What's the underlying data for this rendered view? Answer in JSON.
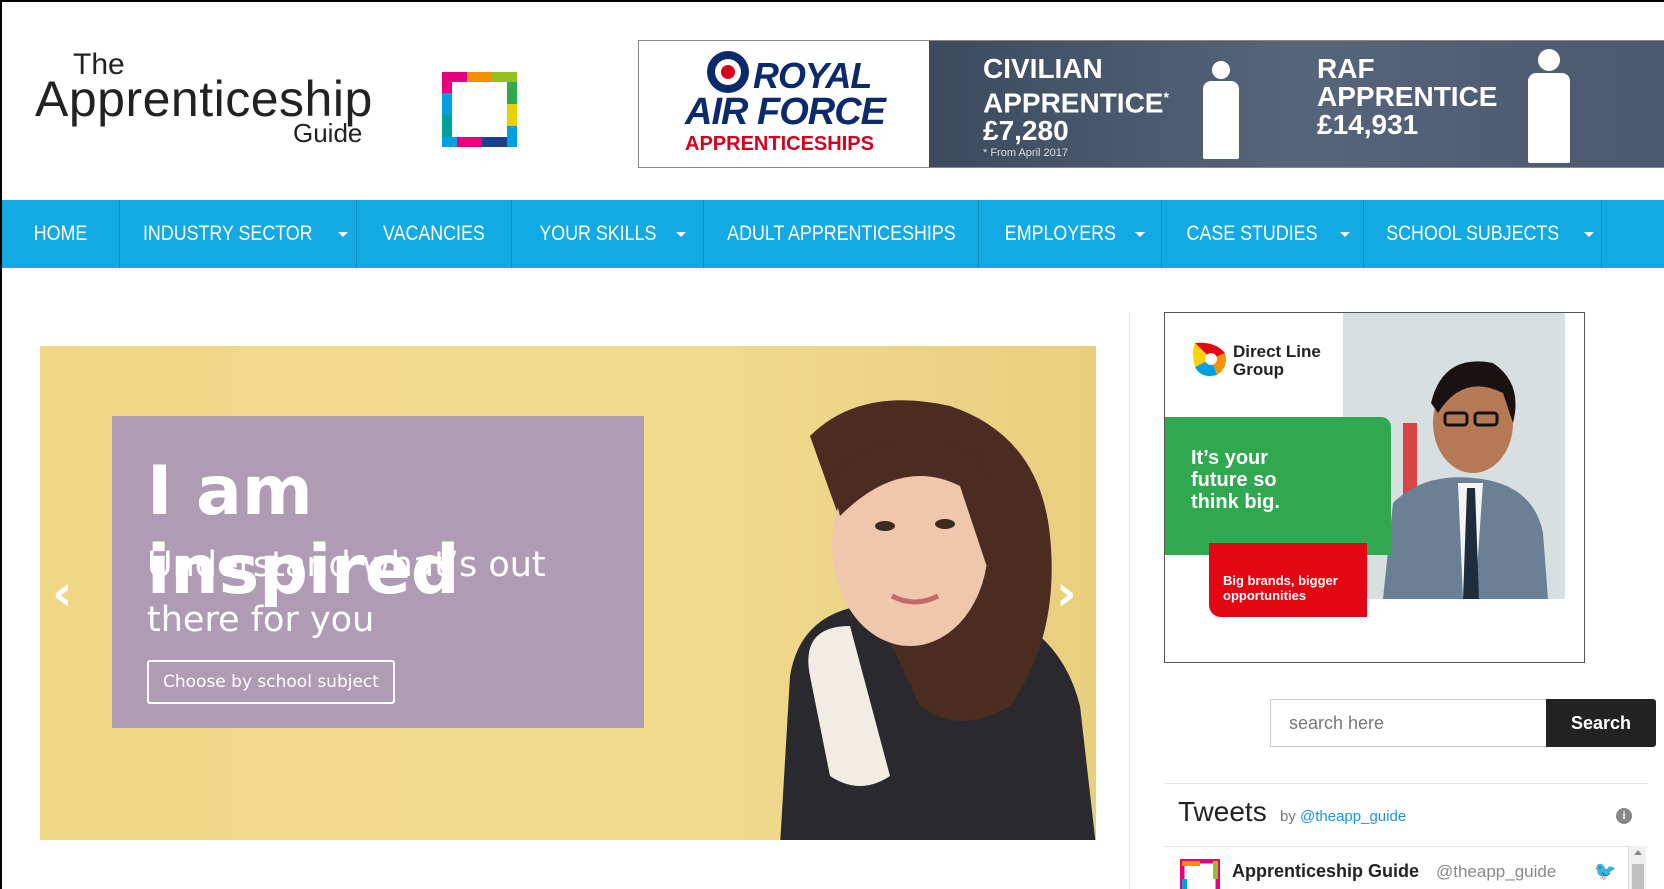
{
  "logo": {
    "line1": "The",
    "line2": "Apprenticeship",
    "line3": "Guide"
  },
  "raf_ad": {
    "royal": "ROYAL",
    "air_force": "AIR FORCE",
    "apprenticeships": "APPRENTICESHIPS",
    "civilian": {
      "line1": "CIVILIAN",
      "line2": "APPRENTICE",
      "mark": "*",
      "salary": "£7,280"
    },
    "raf": {
      "line1": "RAF",
      "line2": "APPRENTICE",
      "salary": "£14,931"
    },
    "note": "* From April 2017"
  },
  "nav": [
    {
      "label": "HOME",
      "dropdown": false
    },
    {
      "label": "INDUSTRY SECTOR",
      "dropdown": true
    },
    {
      "label": "VACANCIES",
      "dropdown": false
    },
    {
      "label": "YOUR SKILLS",
      "dropdown": true
    },
    {
      "label": "ADULT APPRENTICESHIPS",
      "dropdown": false
    },
    {
      "label": "EMPLOYERS",
      "dropdown": true
    },
    {
      "label": "CASE STUDIES",
      "dropdown": true
    },
    {
      "label": "SCHOOL SUBJECTS",
      "dropdown": true
    }
  ],
  "hero": {
    "title": "I am inspired",
    "subtitle": "Understand what’s out there for you",
    "button": "Choose by school subject",
    "prev": "‹",
    "next": "›"
  },
  "sidebar_ad": {
    "brand_line1": "Direct Line",
    "brand_line2": "Group",
    "headline": "It’s your future so think big.",
    "tagline": "Big brands, bigger opportunities"
  },
  "search": {
    "placeholder": "search here",
    "button": "Search"
  },
  "tweets": {
    "title": "Tweets",
    "by": "by",
    "handle": "@theapp_guide",
    "info": "i",
    "author_name": "Apprenticeship Guide",
    "author_handle": "@theapp_guide"
  },
  "colors": {
    "nav": "#13a9e3",
    "hero_bg": "#efd785",
    "hero_box": "#aa96b9",
    "raf_blue": "#0a2a6b",
    "raf_red": "#d6001c",
    "dlg_green": "#2fa84f",
    "dlg_red": "#e30613",
    "search_button": "#222222",
    "twitter_link": "#1b95e0"
  },
  "icons": [
    "apprenticeship-logo-mark",
    "raf-roundel-icon",
    "person-silhouette-icon",
    "chevron-left-icon",
    "chevron-right-icon",
    "caret-down-icon",
    "direct-line-logo-icon",
    "info-icon",
    "twitter-bird-icon"
  ]
}
